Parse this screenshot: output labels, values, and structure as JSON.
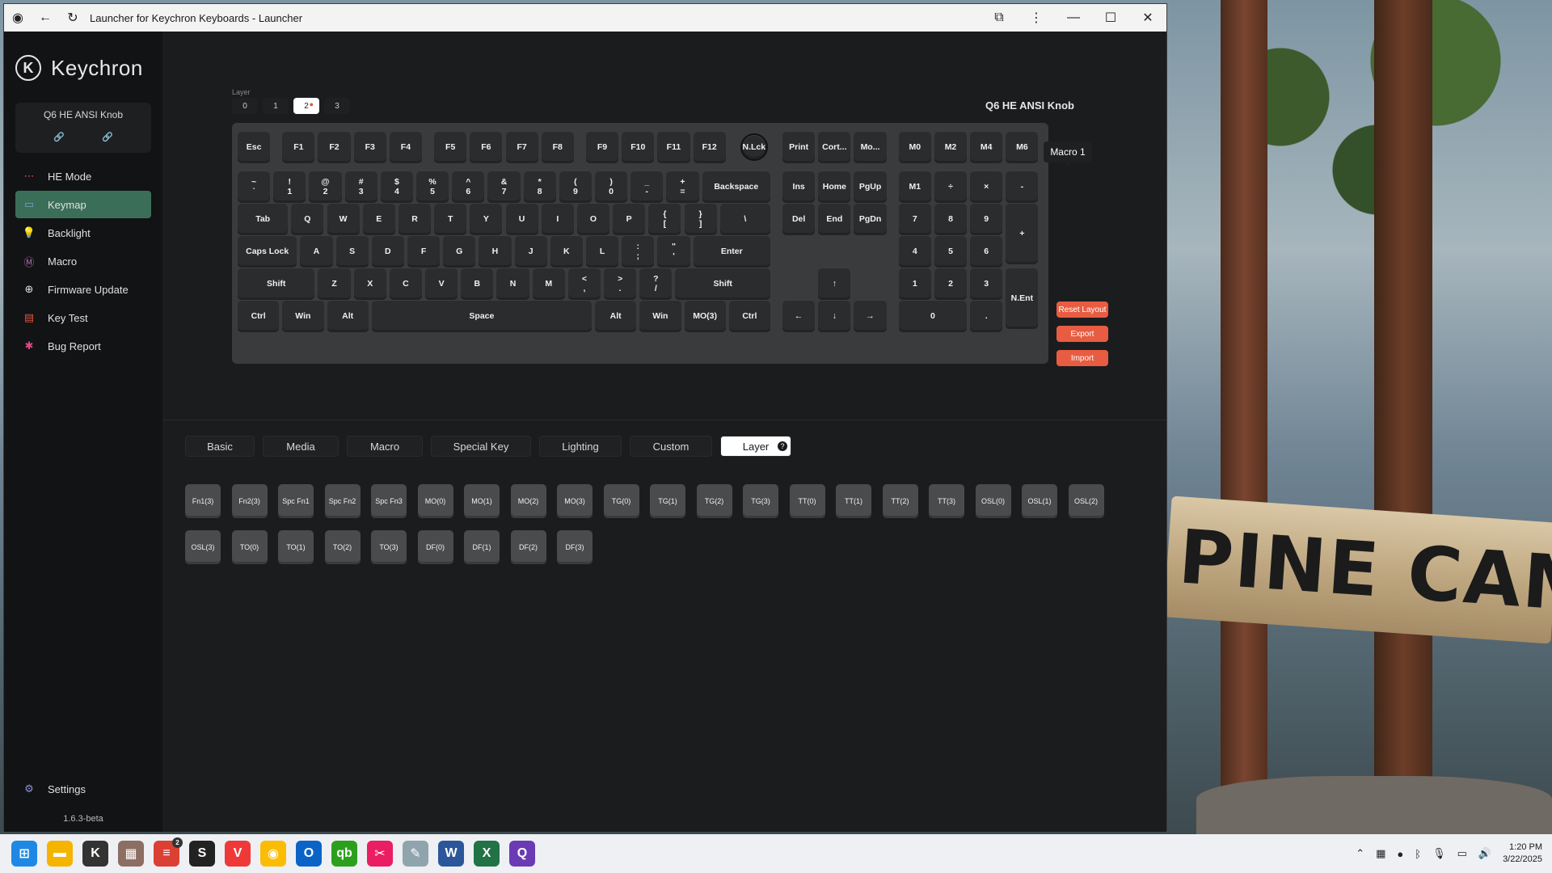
{
  "window": {
    "title": "Launcher for Keychron Keyboards - Launcher"
  },
  "sidebar": {
    "brand": "Keychron",
    "device_name": "Q6 HE ANSI Knob",
    "items": [
      {
        "label": "HE Mode",
        "icon": "he-mode-icon",
        "color": "#e0553d"
      },
      {
        "label": "Keymap",
        "icon": "keymap-icon",
        "color": "#6aa8c8",
        "active": true
      },
      {
        "label": "Backlight",
        "icon": "bulb-icon",
        "color": "#4caf50"
      },
      {
        "label": "Macro",
        "icon": "macro-icon",
        "color": "#b06ab3"
      },
      {
        "label": "Firmware Update",
        "icon": "firmware-icon",
        "color": "#e0e0e0"
      },
      {
        "label": "Key Test",
        "icon": "key-test-icon",
        "color": "#e0553d"
      },
      {
        "label": "Bug Report",
        "icon": "bug-icon",
        "color": "#e04a8a"
      }
    ],
    "settings_label": "Settings",
    "version": "1.6.3-beta"
  },
  "keyboard": {
    "layer_label": "Layer",
    "layers": [
      "0",
      "1",
      "2",
      "3"
    ],
    "active_layer": "2",
    "device_title": "Q6 HE ANSI Knob",
    "tooltip": "Macro 1",
    "buttons": {
      "reset": "Reset Layout",
      "export": "Export",
      "import": "Import"
    },
    "rows": [
      {
        "y": 0,
        "keys": [
          [
            "Esc",
            0,
            1
          ],
          [
            "F1",
            1.25,
            1
          ],
          [
            "F2",
            2.25,
            1
          ],
          [
            "F3",
            3.25,
            1
          ],
          [
            "F4",
            4.25,
            1
          ],
          [
            "F5",
            5.5,
            1
          ],
          [
            "F6",
            6.5,
            1
          ],
          [
            "F7",
            7.5,
            1
          ],
          [
            "F8",
            8.5,
            1
          ],
          [
            "F9",
            9.75,
            1
          ],
          [
            "F10",
            10.75,
            1
          ],
          [
            "F11",
            11.75,
            1
          ],
          [
            "F12",
            12.75,
            1
          ],
          [
            "N.Lck",
            14,
            1,
            "knob"
          ],
          [
            "Print",
            15.25,
            1
          ],
          [
            "Cort...",
            16.25,
            1
          ],
          [
            "Mo...",
            17.25,
            1
          ],
          [
            "M0",
            18.5,
            1
          ],
          [
            "M2",
            19.5,
            1
          ],
          [
            "M4",
            20.5,
            1
          ],
          [
            "M6",
            21.5,
            1
          ]
        ]
      },
      {
        "y": 1.3,
        "keys": [
          [
            "~|`",
            0,
            1
          ],
          [
            "!|1",
            1,
            1
          ],
          [
            "@|2",
            2,
            1
          ],
          [
            "#|3",
            3,
            1
          ],
          [
            "$|4",
            4,
            1
          ],
          [
            "%|5",
            5,
            1
          ],
          [
            "^|6",
            6,
            1
          ],
          [
            "&|7",
            7,
            1
          ],
          [
            "*|8",
            8,
            1
          ],
          [
            "(|9",
            9,
            1
          ],
          [
            ")|0",
            10,
            1
          ],
          [
            "_|-",
            11,
            1
          ],
          [
            "+|=",
            12,
            1
          ],
          [
            "Backspace",
            13,
            2
          ],
          [
            "Ins",
            15.25,
            1
          ],
          [
            "Home",
            16.25,
            1
          ],
          [
            "PgUp",
            17.25,
            1
          ],
          [
            "M1",
            18.5,
            1
          ],
          [
            "÷",
            19.5,
            1
          ],
          [
            "×",
            20.5,
            1
          ],
          [
            "-",
            21.5,
            1
          ]
        ]
      },
      {
        "y": 2.35,
        "keys": [
          [
            "Tab",
            0,
            1.5
          ],
          [
            "Q",
            1.5,
            1
          ],
          [
            "W",
            2.5,
            1
          ],
          [
            "E",
            3.5,
            1
          ],
          [
            "R",
            4.5,
            1
          ],
          [
            "T",
            5.5,
            1
          ],
          [
            "Y",
            6.5,
            1
          ],
          [
            "U",
            7.5,
            1
          ],
          [
            "I",
            8.5,
            1
          ],
          [
            "O",
            9.5,
            1
          ],
          [
            "P",
            10.5,
            1
          ],
          [
            "{|[",
            11.5,
            1
          ],
          [
            "}|]",
            12.5,
            1
          ],
          [
            "||\\",
            13.5,
            1.5
          ],
          [
            "Del",
            15.25,
            1
          ],
          [
            "End",
            16.25,
            1
          ],
          [
            "PgDn",
            17.25,
            1
          ],
          [
            "7",
            18.5,
            1
          ],
          [
            "8",
            19.5,
            1
          ],
          [
            "9",
            20.5,
            1
          ],
          [
            "+",
            21.5,
            1,
            "tall"
          ]
        ]
      },
      {
        "y": 3.4,
        "keys": [
          [
            "Caps Lock",
            0,
            1.75
          ],
          [
            "A",
            1.75,
            1
          ],
          [
            "S",
            2.75,
            1
          ],
          [
            "D",
            3.75,
            1
          ],
          [
            "F",
            4.75,
            1
          ],
          [
            "G",
            5.75,
            1
          ],
          [
            "H",
            6.75,
            1
          ],
          [
            "J",
            7.75,
            1
          ],
          [
            "K",
            8.75,
            1
          ],
          [
            "L",
            9.75,
            1
          ],
          [
            ":|;",
            10.75,
            1
          ],
          [
            "\"|'",
            11.75,
            1
          ],
          [
            "Enter",
            12.75,
            2.25
          ],
          [
            "4",
            18.5,
            1
          ],
          [
            "5",
            19.5,
            1
          ],
          [
            "6",
            20.5,
            1
          ]
        ]
      },
      {
        "y": 4.45,
        "keys": [
          [
            "Shift",
            0,
            2.25
          ],
          [
            "Z",
            2.25,
            1
          ],
          [
            "X",
            3.25,
            1
          ],
          [
            "C",
            4.25,
            1
          ],
          [
            "V",
            5.25,
            1
          ],
          [
            "B",
            6.25,
            1
          ],
          [
            "N",
            7.25,
            1
          ],
          [
            "M",
            8.25,
            1
          ],
          [
            "<|,",
            9.25,
            1
          ],
          [
            ">|.",
            10.25,
            1
          ],
          [
            "?|/",
            11.25,
            1
          ],
          [
            "Shift",
            12.25,
            2.75
          ],
          [
            "↑",
            16.25,
            1
          ],
          [
            "1",
            18.5,
            1
          ],
          [
            "2",
            19.5,
            1
          ],
          [
            "3",
            20.5,
            1
          ],
          [
            "N.Ent",
            21.5,
            1,
            "tall"
          ]
        ]
      },
      {
        "y": 5.5,
        "keys": [
          [
            "Ctrl",
            0,
            1.25
          ],
          [
            "Win",
            1.25,
            1.25
          ],
          [
            "Alt",
            2.5,
            1.25
          ],
          [
            "Space",
            3.75,
            6.25
          ],
          [
            "Alt",
            10,
            1.25
          ],
          [
            "Win",
            11.25,
            1.25
          ],
          [
            "MO(3)",
            12.5,
            1.25
          ],
          [
            "Ctrl",
            13.75,
            1.25
          ],
          [
            "←",
            15.25,
            1
          ],
          [
            "↓",
            16.25,
            1
          ],
          [
            "→",
            17.25,
            1
          ],
          [
            "0",
            18.5,
            2
          ],
          [
            ".",
            20.5,
            1
          ]
        ]
      }
    ]
  },
  "categories": {
    "tabs": [
      "Basic",
      "Media",
      "Macro",
      "Special Key",
      "Lighting",
      "Custom",
      "Layer"
    ],
    "active": "Layer"
  },
  "layer_keys": [
    "Fn1(3)",
    "Fn2(3)",
    "Spc Fn1",
    "Spc Fn2",
    "Spc Fn3",
    "MO(0)",
    "MO(1)",
    "MO(2)",
    "MO(3)",
    "TG(0)",
    "TG(1)",
    "TG(2)",
    "TG(3)",
    "TT(0)",
    "TT(1)",
    "TT(2)",
    "TT(3)",
    "OSL(0)",
    "OSL(1)",
    "OSL(2)",
    "OSL(3)",
    "TO(0)",
    "TO(1)",
    "TO(2)",
    "TO(3)",
    "DF(0)",
    "DF(1)",
    "DF(2)",
    "DF(3)"
  ],
  "taskbar": {
    "apps": [
      {
        "name": "start-icon",
        "color": "#1e88e5",
        "glyph": "⊞"
      },
      {
        "name": "file-explorer-icon",
        "color": "#f4b400",
        "glyph": "▬"
      },
      {
        "name": "keychron-launcher-icon",
        "color": "#333333",
        "glyph": "K"
      },
      {
        "name": "app-icon",
        "color": "#8d6e63",
        "glyph": "▦"
      },
      {
        "name": "todoist-icon",
        "color": "#db4035",
        "glyph": "≡",
        "badge": "2"
      },
      {
        "name": "app-icon",
        "color": "#222222",
        "glyph": "S"
      },
      {
        "name": "vivaldi-icon",
        "color": "#ef3939",
        "glyph": "V"
      },
      {
        "name": "chrome-icon",
        "color": "#fbbc05",
        "glyph": "◉"
      },
      {
        "name": "outlook-icon",
        "color": "#0a64c8",
        "glyph": "O"
      },
      {
        "name": "quickbooks-icon",
        "color": "#2ca01c",
        "glyph": "qb"
      },
      {
        "name": "snipping-icon",
        "color": "#e91e63",
        "glyph": "✂"
      },
      {
        "name": "app-icon",
        "color": "#90a4ae",
        "glyph": "✎"
      },
      {
        "name": "word-icon",
        "color": "#2b579a",
        "glyph": "W"
      },
      {
        "name": "excel-icon",
        "color": "#217346",
        "glyph": "X"
      },
      {
        "name": "app-icon",
        "color": "#6a3bb5",
        "glyph": "Q"
      }
    ],
    "time": "1:20 PM",
    "date": "3/22/2025"
  }
}
